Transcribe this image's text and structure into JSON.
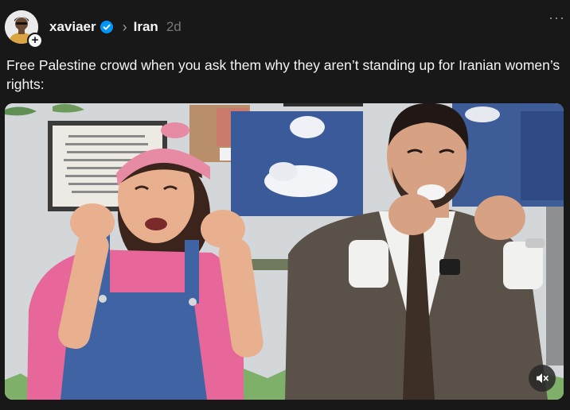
{
  "post": {
    "author": "xaviaer",
    "verified": true,
    "topic": "Iran",
    "time_ago": "2d",
    "more_label": "···",
    "caption": "Free Palestine crowd when you ask them why they aren’t standing up for Iranian women’s rights:"
  },
  "icons": {
    "avatar_follow": "plus-icon",
    "verified": "verified-badge-icon",
    "separator": "chevron-right-icon",
    "more": "more-horizontal-icon",
    "mute": "volume-muted-icon"
  },
  "colors": {
    "background": "#181818",
    "text": "#f3f5f7",
    "muted": "#777777",
    "verified": "#0095f6"
  }
}
